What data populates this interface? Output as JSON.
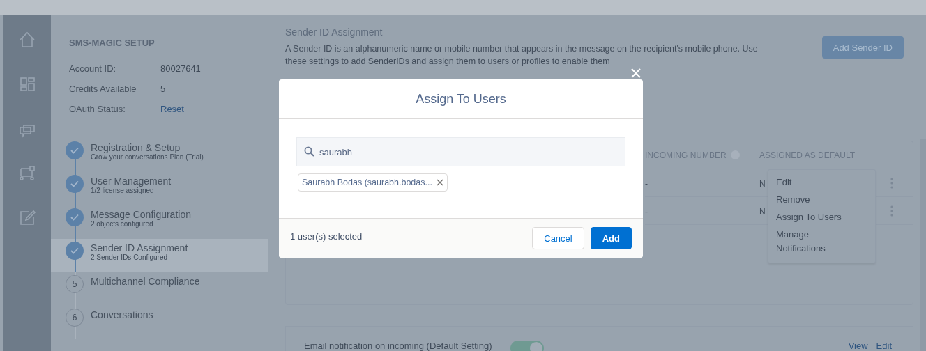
{
  "setup": {
    "title": "SMS-MAGIC SETUP",
    "fields": [
      {
        "label": "Account ID:",
        "value": "80027641",
        "kind": "text"
      },
      {
        "label": "Credits Available",
        "value": "5",
        "kind": "text"
      },
      {
        "label": "OAuth Status:",
        "value": "Reset",
        "kind": "link"
      }
    ]
  },
  "steps": [
    {
      "title": "Registration & Setup",
      "subtitle": "Grow your conversations Plan (Trial)",
      "done": true,
      "selected": false
    },
    {
      "title": "User Management",
      "subtitle": "1/2 license assigned",
      "done": true,
      "selected": false
    },
    {
      "title": "Message Configuration",
      "subtitle": "2 objects configured",
      "done": true,
      "selected": false
    },
    {
      "title": "Sender ID Assignment",
      "subtitle": "2 Sender IDs Configured",
      "done": true,
      "selected": true
    },
    {
      "number": "5",
      "title": "Multichannel Compliance",
      "done": false,
      "selected": false
    },
    {
      "number": "6",
      "title": "Conversations",
      "done": false,
      "selected": false
    }
  ],
  "section": {
    "title": "Sender ID Assignment",
    "description": "A Sender ID is an alphanumeric name or mobile number that appears in the message on the recipient's mobile phone. Use these settings to add SenderIDs and assign them to users or profiles to enable them",
    "button": "Add Sender ID"
  },
  "table": {
    "columns": [
      "INCOMING NUMBER",
      "ASSIGNED AS DEFAULT"
    ],
    "rows": [
      [
        "-",
        "N"
      ],
      [
        "-",
        "N"
      ]
    ]
  },
  "row_menu": {
    "items": [
      "Edit",
      "Remove",
      "Assign To Users",
      "Manage Notifications"
    ]
  },
  "notification": {
    "label": "Email notification on incoming (Default Setting)",
    "on": true,
    "links": [
      "View",
      "Edit"
    ]
  },
  "modal": {
    "title": "Assign To Users",
    "search": {
      "value": "saurabh"
    },
    "chips": [
      {
        "label": "Saurabh Bodas (saurabh.bodas..."
      }
    ],
    "footer_text": "1 user(s) selected",
    "buttons": [
      {
        "label": "Cancel",
        "kind": "secondary"
      },
      {
        "label": "Add",
        "kind": "primary"
      }
    ]
  }
}
